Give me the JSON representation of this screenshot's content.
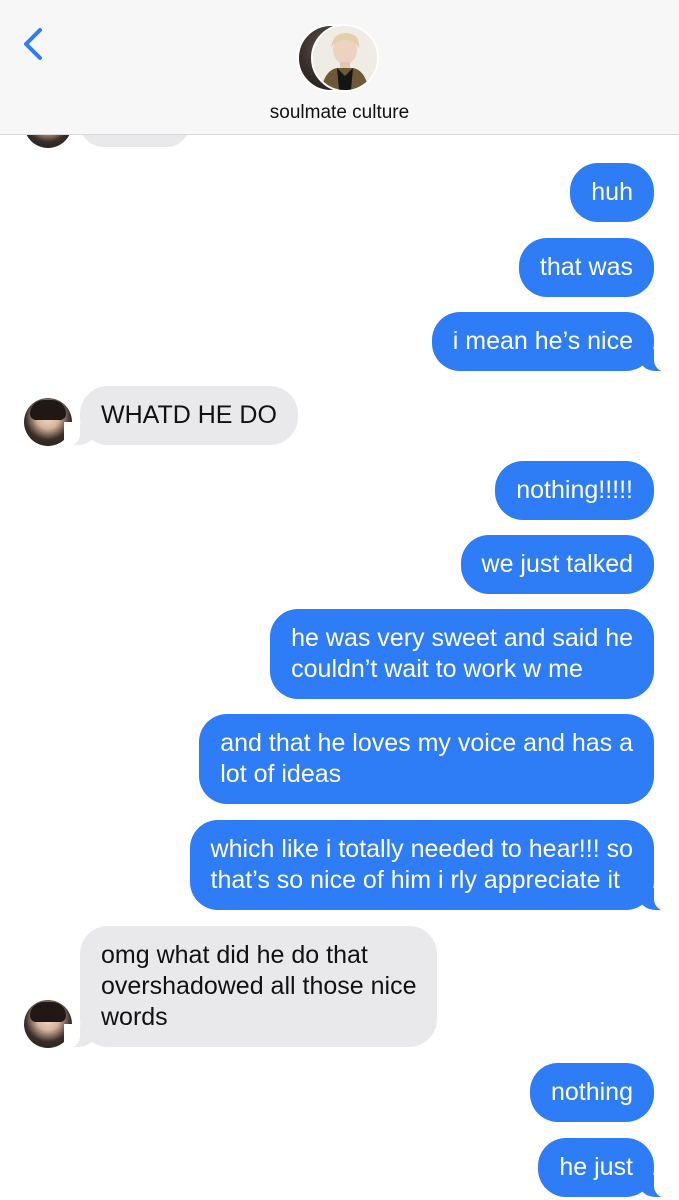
{
  "header": {
    "contact_name": "soulmate culture",
    "back_icon": "chevron-left-icon",
    "accent_color": "#2e7cf6"
  },
  "messages": [
    {
      "sender": "me",
      "text": "huh"
    },
    {
      "sender": "me",
      "text": "that was"
    },
    {
      "sender": "me",
      "text": "i mean he’s nice"
    },
    {
      "sender": "them",
      "text": "WHATD HE DO"
    },
    {
      "sender": "me",
      "text": "nothing!!!!!"
    },
    {
      "sender": "me",
      "text": "we just talked"
    },
    {
      "sender": "me",
      "lines": [
        "he was very sweet and said he",
        "couldn’t wait to work w me"
      ]
    },
    {
      "sender": "me",
      "lines": [
        "and that he loves my voice and has a",
        "lot of ideas"
      ]
    },
    {
      "sender": "me",
      "lines": [
        "which like i totally needed to hear!!! so",
        "that’s so nice of him i rly appreciate it"
      ]
    },
    {
      "sender": "them",
      "lines": [
        "omg what did he do that",
        "overshadowed all those nice",
        "words"
      ]
    },
    {
      "sender": "me",
      "text": "nothing"
    },
    {
      "sender": "me",
      "text": "he just"
    }
  ],
  "colors": {
    "outgoing_bubble": "#2e7cf6",
    "incoming_bubble": "#e9e9eb"
  }
}
